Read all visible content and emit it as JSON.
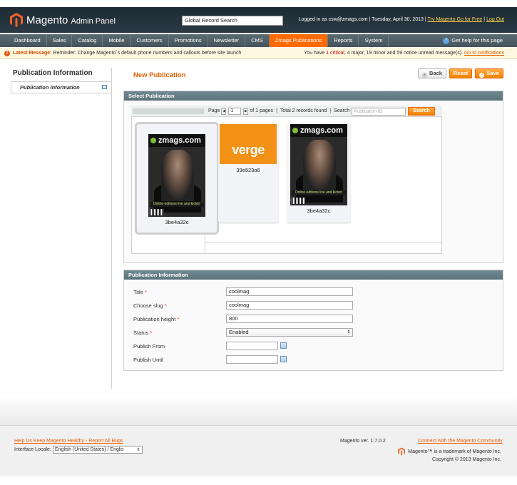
{
  "header": {
    "logo_text": "Magento",
    "logo_sub": "Admin Panel",
    "global_search": "Global Record Search",
    "logged_in": "Logged in as csw@zmags.com",
    "date": "Tuesday, April 30, 2013",
    "try_link": "Try Magento Go for Free",
    "logout": "Log Out",
    "separator": "|"
  },
  "nav": {
    "items": [
      "Dashboard",
      "Sales",
      "Catalog",
      "Mobile",
      "Customers",
      "Promotions",
      "Newsletter",
      "CMS",
      "Zmags Publications",
      "Reports",
      "System"
    ],
    "active_index": 8,
    "help": "Get help for this page"
  },
  "message": {
    "label": "Latest Message:",
    "text": "Reminder: Change Magento`s default phone numbers and callouts before site launch",
    "right_pre": "You have",
    "critical": "1 critical",
    "right_mid": ", 4 major, 19 minor and 59 notice unread message(s).",
    "notif_link": "Go to notifications"
  },
  "sidebar": {
    "title": "Publication Information",
    "tab": "Publication Information"
  },
  "page": {
    "title": "New Publication",
    "back": "Back",
    "reset": "Reset",
    "save": "Save"
  },
  "select_section": {
    "title": "Select Publication",
    "pager_page": "Page",
    "pager_value": "1",
    "pager_of": "of 1 pages",
    "records": "Total 2 records found",
    "search_label": "Search",
    "search_placeholder": "Publication ID",
    "search_btn": "Search",
    "cards": [
      {
        "id": "3be4a32c",
        "brand": "zmags.com",
        "tag": "Online editions live and kickin'"
      },
      {
        "id": "39e523a6",
        "brand": "verge"
      },
      {
        "id": "3be4a32c",
        "brand": "zmags.com",
        "tag": "Online editions live and kickin'"
      }
    ]
  },
  "form_section": {
    "title": "Publication Information",
    "fields": [
      {
        "label": "Title",
        "required": true,
        "value": "coolmag"
      },
      {
        "label": "Choose slug",
        "required": true,
        "value": "coolmag"
      },
      {
        "label": "Publication height",
        "required": true,
        "value": "800"
      },
      {
        "label": "Status",
        "required": true,
        "value": "Enabled"
      },
      {
        "label": "Publish From",
        "required": false,
        "value": ""
      },
      {
        "label": "Publish Until",
        "required": false,
        "value": ""
      }
    ],
    "req_mark": "*"
  },
  "footer": {
    "links": "Help Us Keep Magento Healthy - Report All Bugs",
    "locale_label": "Interface Locale:",
    "locale_value": "English (United States) / Englis",
    "version": "Magento ver. 1.7.0.2",
    "community": "Connect with the Magento Community",
    "trademark": "Magento™ is a trademark of Magento Inc.",
    "copyright": "Copyright © 2013 Magento Inc."
  },
  "colors": {
    "accent": "#eb5e00",
    "nav_active": "#ff6b00",
    "header_bg": "#1d2a33"
  }
}
